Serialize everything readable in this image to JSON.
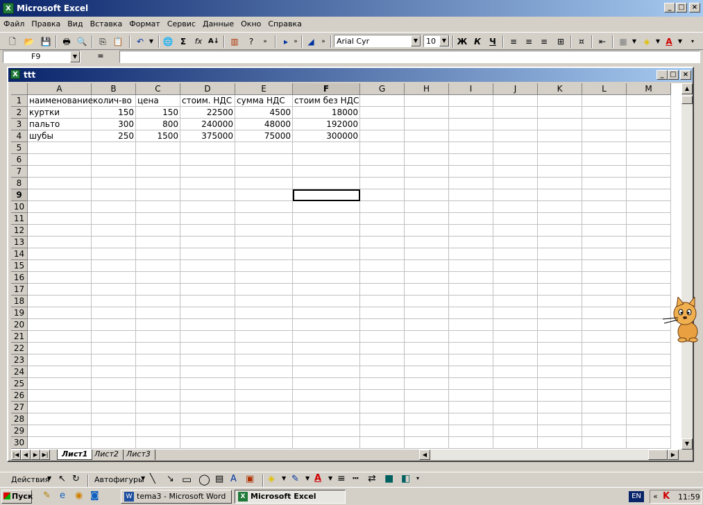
{
  "window": {
    "title": "Microsoft Excel",
    "icon_text": "X"
  },
  "menu": [
    "Файл",
    "Правка",
    "Вид",
    "Вставка",
    "Формат",
    "Сервис",
    "Данные",
    "Окно",
    "Справка"
  ],
  "toolbar": {
    "font_name": "Arial Cyr",
    "font_size": "10",
    "bold": "Ж",
    "italic": "К",
    "underline": "Ч",
    "sum": "Σ",
    "fx": "fx"
  },
  "formula": {
    "name_box": "F9",
    "equals": "=",
    "value": ""
  },
  "workbook": {
    "title": "ttt"
  },
  "grid": {
    "columns": [
      "A",
      "B",
      "C",
      "D",
      "E",
      "F",
      "G",
      "H",
      "I",
      "J",
      "K",
      "L",
      "M"
    ],
    "rows": [
      "1",
      "2",
      "3",
      "4",
      "5",
      "6",
      "7",
      "8",
      "9",
      "10",
      "11",
      "12",
      "13",
      "14",
      "15",
      "16",
      "17",
      "18",
      "19",
      "20",
      "21",
      "22",
      "23",
      "24",
      "25",
      "26",
      "27",
      "28",
      "29",
      "30"
    ],
    "data": [
      [
        "наименование",
        "колич-во",
        "цена",
        "стоим. НДС",
        "сумма НДС",
        "стоим без НДС"
      ],
      [
        "куртки",
        "150",
        "150",
        "22500",
        "4500",
        "18000"
      ],
      [
        "пальто",
        "300",
        "800",
        "240000",
        "48000",
        "192000"
      ],
      [
        "шубы",
        "250",
        "1500",
        "375000",
        "75000",
        "300000"
      ]
    ],
    "selected_cell": "F9"
  },
  "sheets": [
    "Лист1",
    "Лист2",
    "Лист3"
  ],
  "drawing": {
    "actions": "Действия",
    "autoshapes": "Автофигуры"
  },
  "taskbar": {
    "start": "Пуск",
    "tasks": [
      "tema3 - Microsoft Word",
      "Microsoft Excel"
    ],
    "lang": "EN",
    "time": "11:59"
  }
}
